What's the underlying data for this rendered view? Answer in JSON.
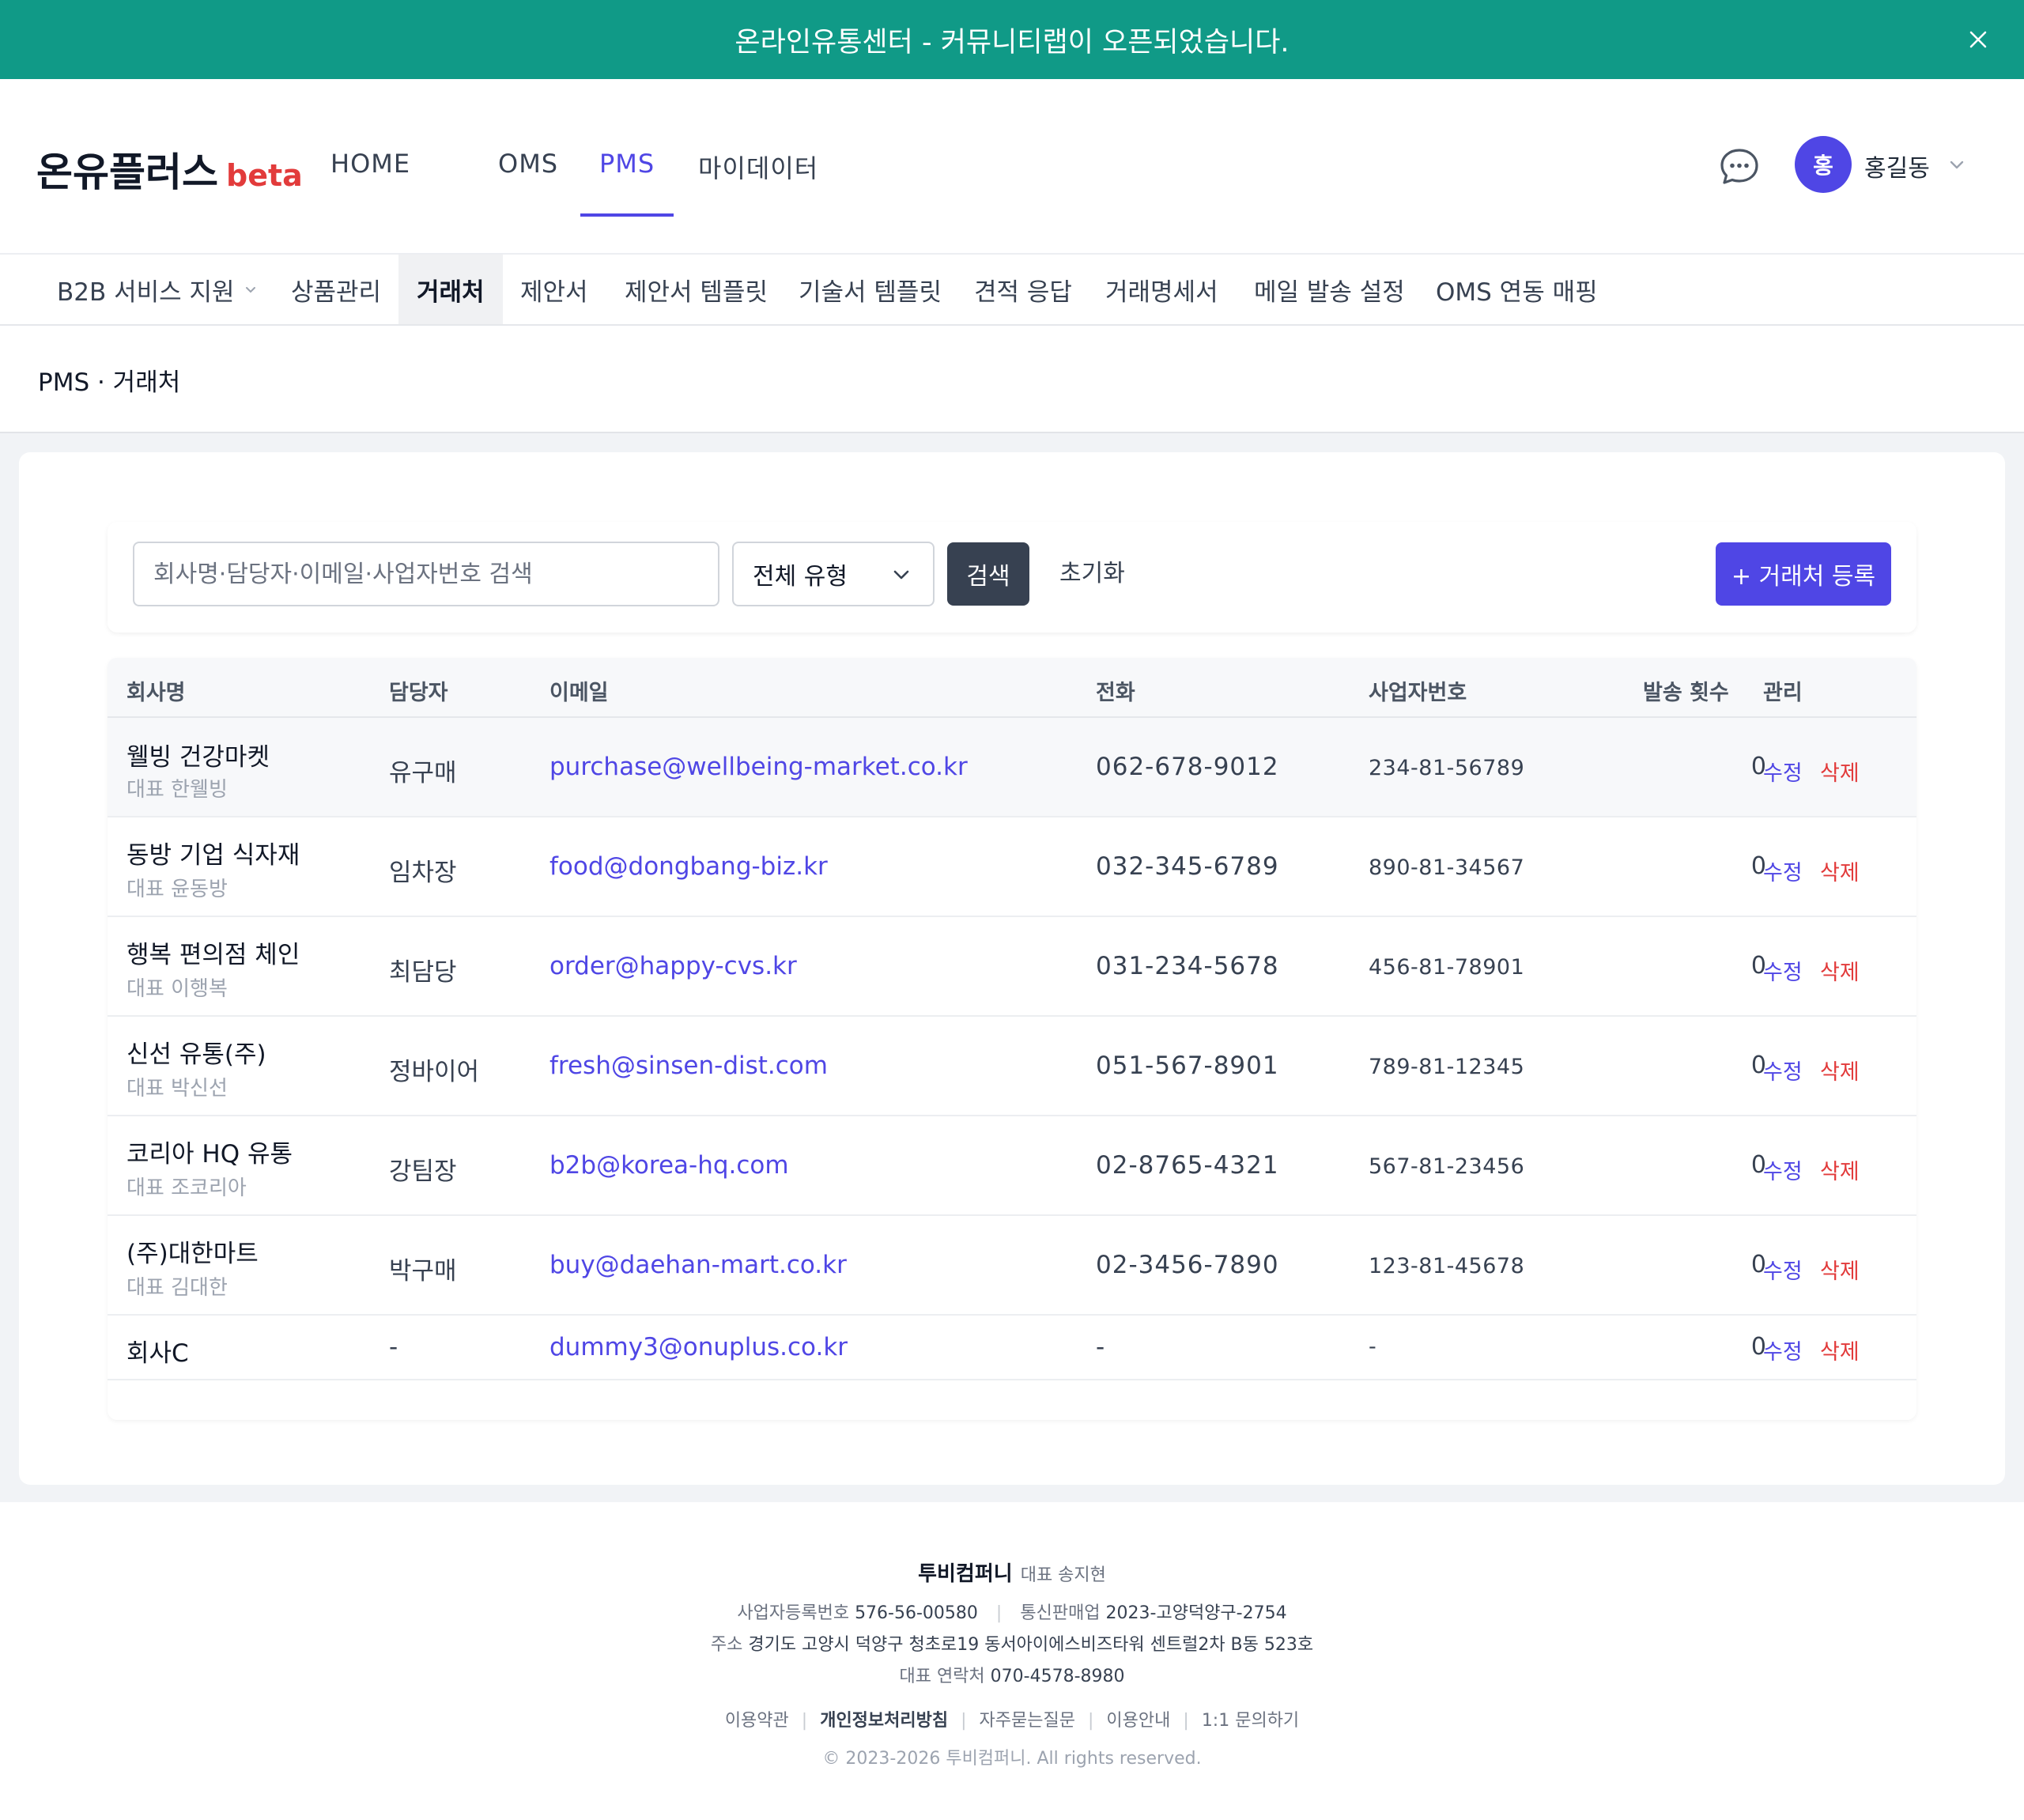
{
  "banner": {
    "text": "온라인유통센터 - 커뮤니티랩이 오픈되었습니다."
  },
  "header": {
    "logo": "온유플러스",
    "logo_badge": "beta",
    "nav": [
      {
        "label": "HOME"
      },
      {
        "label": "OMS"
      },
      {
        "label": "PMS"
      },
      {
        "label": "마이데이터"
      }
    ],
    "active_nav": "PMS",
    "user": {
      "avatar_initial": "홍",
      "name": "홍길동"
    }
  },
  "subnav": {
    "items": [
      {
        "label": "B2B 서비스 지원"
      },
      {
        "label": "상품관리"
      },
      {
        "label": "거래처"
      },
      {
        "label": "제안서"
      },
      {
        "label": "제안서 템플릿"
      },
      {
        "label": "기술서 템플릿"
      },
      {
        "label": "견적 응답"
      },
      {
        "label": "거래명세서"
      },
      {
        "label": "메일 발송 설정"
      },
      {
        "label": "OMS 연동 매핑"
      }
    ],
    "active": "거래처"
  },
  "breadcrumb": "PMS · 거래처",
  "toolbar": {
    "search_placeholder": "회사명·담당자·이메일·사업자번호 검색",
    "type_select": "전체 유형",
    "search_button": "검색",
    "reset_button": "초기화",
    "add_button": "+ 거래처 등록"
  },
  "table": {
    "columns": [
      "회사명",
      "담당자",
      "이메일",
      "전화",
      "사업자번호",
      "발송 횟수",
      "관리"
    ],
    "edit_label": "수정",
    "delete_label": "삭제",
    "rows": [
      {
        "company": "웰빙 건강마켓",
        "rep": "대표 한웰빙",
        "contact": "유구매",
        "email": "purchase@wellbeing-market.co.kr",
        "phone": "062-678-9012",
        "biz_no": "234-81-56789",
        "sent": "0"
      },
      {
        "company": "동방 기업 식자재",
        "rep": "대표 윤동방",
        "contact": "임차장",
        "email": "food@dongbang-biz.kr",
        "phone": "032-345-6789",
        "biz_no": "890-81-34567",
        "sent": "0"
      },
      {
        "company": "행복 편의점 체인",
        "rep": "대표 이행복",
        "contact": "최담당",
        "email": "order@happy-cvs.kr",
        "phone": "031-234-5678",
        "biz_no": "456-81-78901",
        "sent": "0"
      },
      {
        "company": "신선 유통(주)",
        "rep": "대표 박신선",
        "contact": "정바이어",
        "email": "fresh@sinsen-dist.com",
        "phone": "051-567-8901",
        "biz_no": "789-81-12345",
        "sent": "0"
      },
      {
        "company": "코리아 HQ 유통",
        "rep": "대표 조코리아",
        "contact": "강팀장",
        "email": "b2b@korea-hq.com",
        "phone": "02-8765-4321",
        "biz_no": "567-81-23456",
        "sent": "0"
      },
      {
        "company": "(주)대한마트",
        "rep": "대표 김대한",
        "contact": "박구매",
        "email": "buy@daehan-mart.co.kr",
        "phone": "02-3456-7890",
        "biz_no": "123-81-45678",
        "sent": "0"
      },
      {
        "company": "회사C",
        "rep": "",
        "contact": "-",
        "email": "dummy3@onuplus.co.kr",
        "phone": "-",
        "biz_no": "-",
        "sent": "0"
      }
    ]
  },
  "footer": {
    "company": "투비컴퍼니",
    "ceo": "대표 송지현",
    "biz_reg_label": "사업자등록번호",
    "biz_reg": "576-56-00580",
    "ecommerce_label": "통신판매업",
    "ecommerce": "2023-고양덕양구-2754",
    "address_label": "주소",
    "address": "경기도 고양시 덕양구 청초로19 동서아이에스비즈타워 센트럴2차 B동 523호",
    "contact_label": "대표 연락처",
    "contact": "070-4578-8980",
    "links": [
      "이용약관",
      "개인정보처리방침",
      "자주묻는질문",
      "이용안내",
      "1:1 문의하기"
    ],
    "copyright": "© 2023-2026 투비컴퍼니. All rights reserved."
  }
}
